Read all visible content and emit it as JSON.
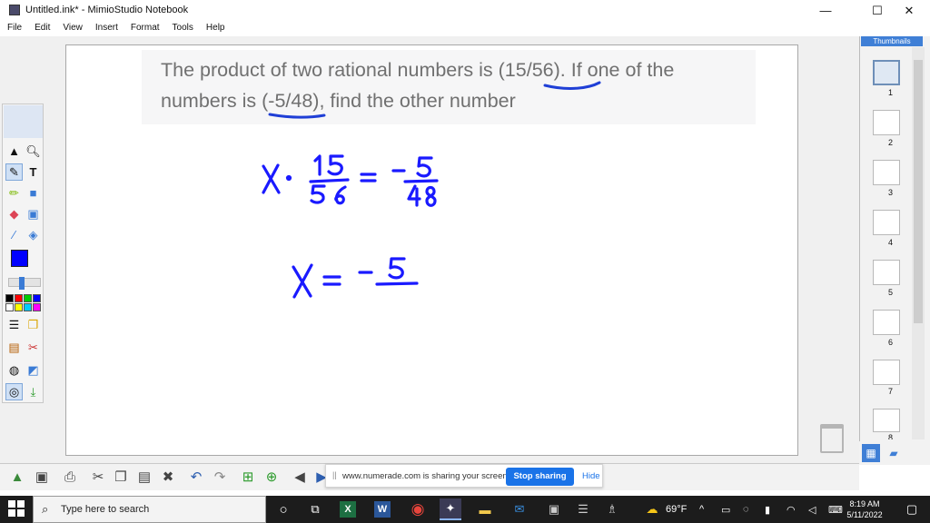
{
  "window": {
    "title": "Untitled.ink* - MimioStudio Notebook",
    "minimize": "—",
    "maximize": "☐",
    "close": "✕"
  },
  "menu": [
    "File",
    "Edit",
    "View",
    "Insert",
    "Format",
    "Tools",
    "Help"
  ],
  "question": {
    "line1": "The product of two rational numbers is (15/56). If one of the",
    "line2": "numbers is (-5/48), find the other number"
  },
  "ink": {
    "color": "#1a1aff",
    "underline_color": "#1f3fd6"
  },
  "toolbox": {
    "current_color": "#0000ff",
    "palette": [
      "#000000",
      "#ff0000",
      "#00cc00",
      "#0000ff",
      "#ffffff",
      "#ffff00",
      "#00ccff",
      "#ff00ff"
    ]
  },
  "thumbnails": {
    "header": "Thumbnails",
    "pages": [
      "1",
      "2",
      "3",
      "4",
      "5",
      "6",
      "7",
      "8"
    ]
  },
  "share": {
    "message": "www.numerade.com is sharing your screen.",
    "grip": "||",
    "stop_label": "Stop sharing",
    "hide_label": "Hide"
  },
  "taskbar": {
    "search_placeholder": "Type here to search",
    "weather": "69°F",
    "time": "8:19 AM",
    "date": "5/11/2022"
  }
}
